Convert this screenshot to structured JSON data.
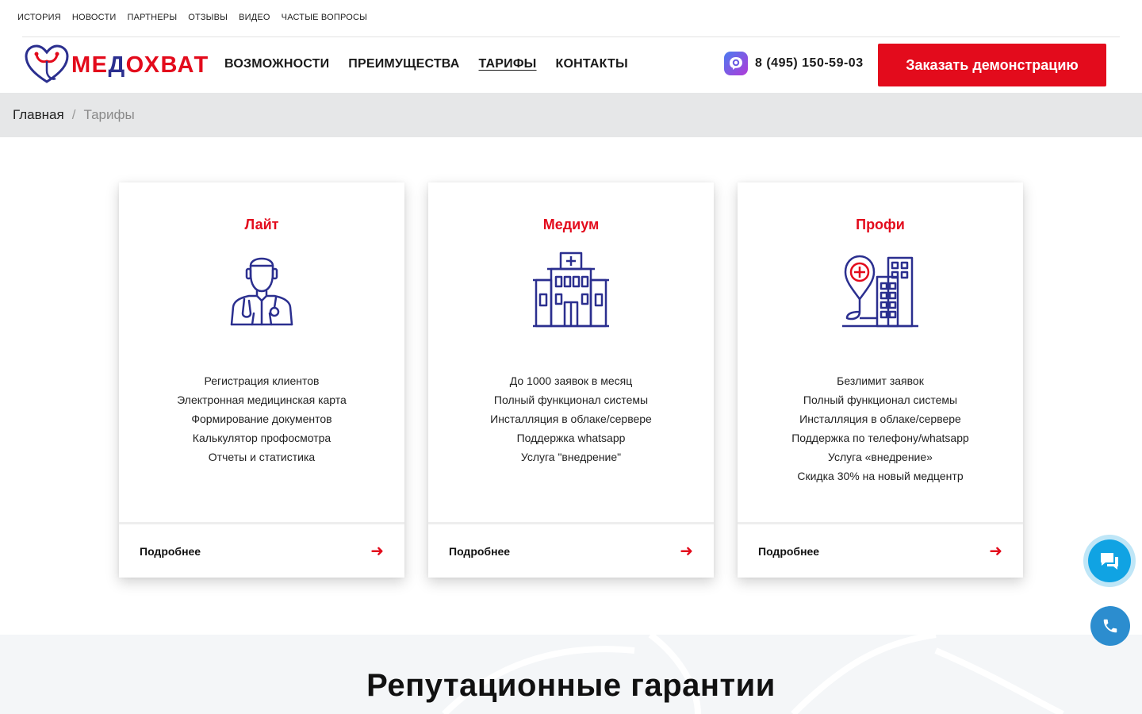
{
  "topnav": [
    "ИСТОРИЯ",
    "НОВОСТИ",
    "ПАРТНЕРЫ",
    "ОТЗЫВЫ",
    "ВИДЕО",
    "ЧАСТЫЕ ВОПРОСЫ"
  ],
  "logo": {
    "text_red": "МЕ",
    "text_blue": "Д",
    "text_red2": "ОХВАТ"
  },
  "nav": [
    "ВОЗМОЖНОСТИ",
    "ПРЕИМУЩЕСТВА",
    "ТАРИФЫ",
    "КОНТАКТЫ"
  ],
  "phone": "8 (495) 150-59-03",
  "demo_button": "Заказать демонстрацию",
  "breadcrumb": {
    "home": "Главная",
    "separator": "/",
    "current": "Тарифы"
  },
  "cards": [
    {
      "title": "Лайт",
      "icon": "doctor-icon",
      "features": [
        "Регистрация клиентов",
        "Электронная медицинская карта",
        "Формирование документов",
        "Калькулятор профосмотра",
        "Отчеты и статистика"
      ],
      "more": "Подробнее"
    },
    {
      "title": "Медиум",
      "icon": "hospital-icon",
      "features": [
        "До 1000 заявок в месяц",
        "Полный функционал системы",
        "Инсталляция в облаке/сервере",
        "Поддержка whatsapp",
        "Услуга \"внедрение\""
      ],
      "more": "Подробнее"
    },
    {
      "title": "Профи",
      "icon": "clinic-location-icon",
      "features": [
        "Безлимит заявок",
        "Полный функционал системы",
        "Инсталляция в облаке/сервере",
        "Поддержка по телефону/whatsapp",
        "Услуга «внедрение»",
        "Скидка 30% на новый медцентр"
      ],
      "more": "Подробнее"
    }
  ],
  "section_title": "Репутационные гарантии",
  "colors": {
    "accent_red": "#e30b1c",
    "brand_blue": "#2b2f8f",
    "chat_blue": "#10a3e3"
  }
}
